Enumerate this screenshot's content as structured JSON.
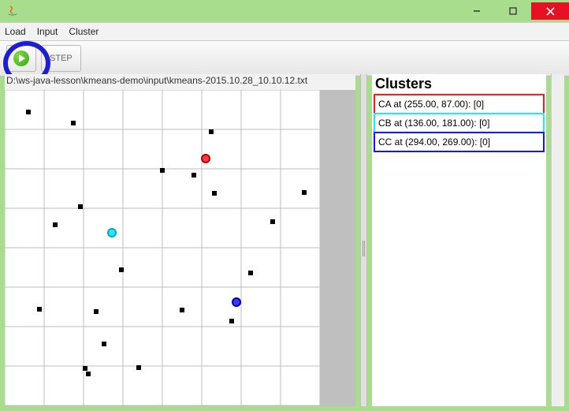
{
  "window": {
    "title": ""
  },
  "menu": {
    "load": "Load",
    "input": "Input",
    "cluster": "Cluster"
  },
  "toolbar": {
    "step_label": "STEP"
  },
  "path": "D:\\ws-java-lesson\\kmeans-demo\\input\\kmeans-2015.10.28_10.10.12.txt",
  "clusters": {
    "title": "Clusters",
    "rows": [
      {
        "label": "CA at (255.00, 87.00): [0]",
        "color": "#ff1a1a"
      },
      {
        "label": "CB at (136.00, 181.00): [0]",
        "color": "#23e8f7"
      },
      {
        "label": "CC at (294.00, 269.00): [0]",
        "color": "#1414ff"
      }
    ]
  },
  "chart_data": {
    "type": "scatter",
    "xlim": [
      0,
      400
    ],
    "ylim": [
      0,
      400
    ],
    "grid": {
      "x_step": 50,
      "y_step": 50
    },
    "points": [
      {
        "x": 30,
        "y": 28
      },
      {
        "x": 87,
        "y": 42
      },
      {
        "x": 64,
        "y": 171
      },
      {
        "x": 96,
        "y": 148
      },
      {
        "x": 44,
        "y": 278
      },
      {
        "x": 116,
        "y": 281
      },
      {
        "x": 102,
        "y": 353
      },
      {
        "x": 170,
        "y": 352
      },
      {
        "x": 148,
        "y": 228
      },
      {
        "x": 225,
        "y": 279
      },
      {
        "x": 262,
        "y": 53
      },
      {
        "x": 240,
        "y": 108
      },
      {
        "x": 266,
        "y": 131
      },
      {
        "x": 200,
        "y": 102
      },
      {
        "x": 312,
        "y": 232
      },
      {
        "x": 288,
        "y": 293
      },
      {
        "x": 340,
        "y": 167
      },
      {
        "x": 380,
        "y": 130
      },
      {
        "x": 126,
        "y": 322
      },
      {
        "x": 106,
        "y": 360
      }
    ],
    "centroids": [
      {
        "name": "CA",
        "x": 255,
        "y": 87,
        "fill": "#ff3b3b",
        "stroke": "#b00000"
      },
      {
        "name": "CB",
        "x": 136,
        "y": 181,
        "fill": "#23e8f7",
        "stroke": "#0aa8b6"
      },
      {
        "name": "CC",
        "x": 294,
        "y": 269,
        "fill": "#3a3aff",
        "stroke": "#0000b0"
      }
    ]
  }
}
